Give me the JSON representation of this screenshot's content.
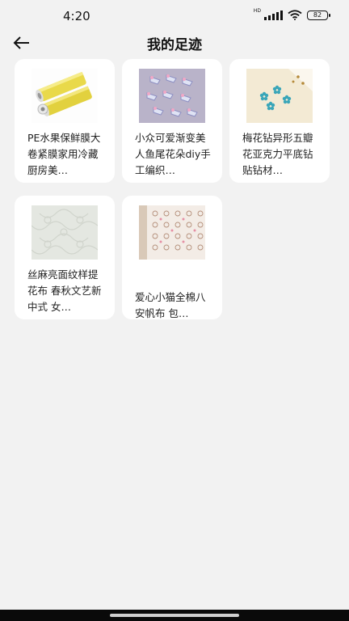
{
  "status_bar": {
    "time": "4:20",
    "network_label": "HD",
    "battery": "82"
  },
  "header": {
    "title": "我的足迹",
    "back_icon": "arrow-left-icon"
  },
  "items": [
    {
      "title": "PE水果保鲜膜大卷紧膜家用冷藏厨房美…"
    },
    {
      "title": "小众可爱渐变美人鱼尾花朵diy手工编织…"
    },
    {
      "title": "梅花钻异形五瓣花亚克力平底钻贴钻材…"
    },
    {
      "title": "丝麻亮面纹样提花布 春秋文艺新中式 女…"
    },
    {
      "title": "爱心小猫全棉八安帆布 包…"
    }
  ]
}
